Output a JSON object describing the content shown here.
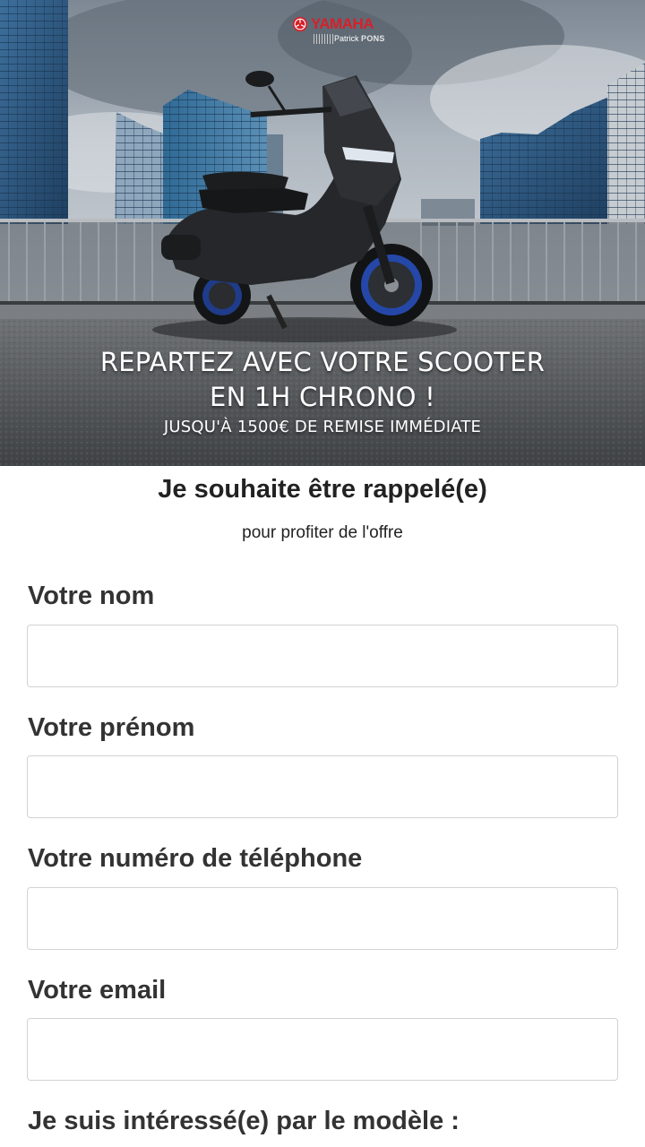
{
  "hero": {
    "brand": {
      "name": "YAMAHA",
      "dealer_prefix": "Patrick",
      "dealer_name": "PONS"
    },
    "headline_line1": "REPARTEZ AVEC VOTRE SCOOTER",
    "headline_line2": "EN 1H CHRONO !",
    "subline": "JUSQU'À 1500€ DE REMISE IMMÉDIATE"
  },
  "form": {
    "title": "Je souhaite être rappelé(e)",
    "subtitle": "pour profiter de l'offre",
    "fields": [
      {
        "label": "Votre nom",
        "value": ""
      },
      {
        "label": "Votre prénom",
        "value": ""
      },
      {
        "label": "Votre numéro de téléphone",
        "value": ""
      },
      {
        "label": "Votre email",
        "value": ""
      }
    ],
    "model_label": "Je suis intéressé(e) par le modèle :"
  },
  "colors": {
    "brand_red": "#d6202a",
    "label_text": "#333333",
    "input_border": "#d3d3d3"
  }
}
